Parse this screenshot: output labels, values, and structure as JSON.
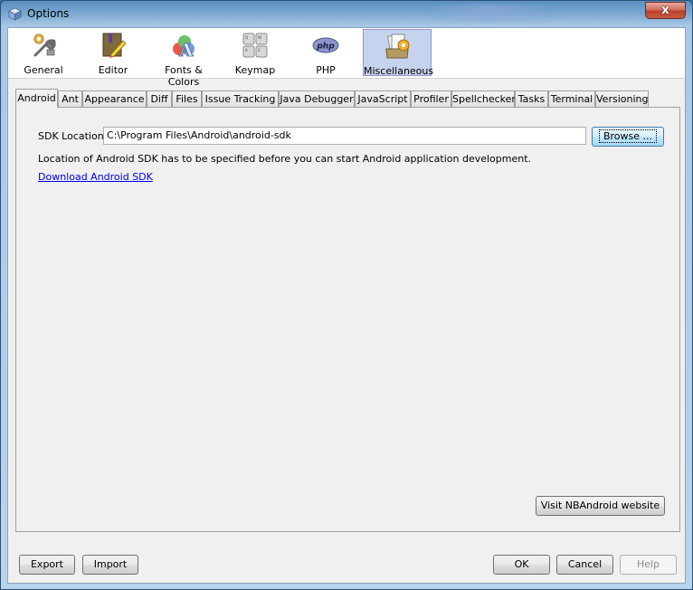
{
  "window": {
    "title": "Options",
    "close_label": "x"
  },
  "categories": [
    {
      "label": "General",
      "icon": "wrench-gear-icon",
      "selected": false
    },
    {
      "label": "Editor",
      "icon": "book-pencil-icon",
      "selected": false
    },
    {
      "label": "Fonts & Colors",
      "icon": "fonts-colors-icon",
      "selected": false
    },
    {
      "label": "Keymap",
      "icon": "keyboard-keys-icon",
      "selected": false
    },
    {
      "label": "PHP",
      "icon": "php-logo-icon",
      "selected": false
    },
    {
      "label": "Miscellaneous",
      "icon": "folder-gear-icon",
      "selected": true
    }
  ],
  "tabs": [
    {
      "label": "Android",
      "active": true
    },
    {
      "label": "Ant"
    },
    {
      "label": "Appearance"
    },
    {
      "label": "Diff"
    },
    {
      "label": "Files"
    },
    {
      "label": "Issue Tracking"
    },
    {
      "label": "Java Debugger"
    },
    {
      "label": "JavaScript"
    },
    {
      "label": "Profiler"
    },
    {
      "label": "Spellchecker"
    },
    {
      "label": "Tasks"
    },
    {
      "label": "Terminal"
    },
    {
      "label": "Versioning"
    }
  ],
  "android": {
    "sdk_label": "SDK Location:",
    "sdk_value": "C:\\Program Files\\Android\\android-sdk",
    "browse_label": "Browse ...",
    "info_text": "Location of Android SDK has to be specified before you can start Android application development.",
    "download_link": "Download Android SDK",
    "visit_label": "Visit NBAndroid website"
  },
  "footer": {
    "export_label": "Export",
    "import_label": "Import",
    "ok_label": "OK",
    "cancel_label": "Cancel",
    "help_label": "Help"
  }
}
